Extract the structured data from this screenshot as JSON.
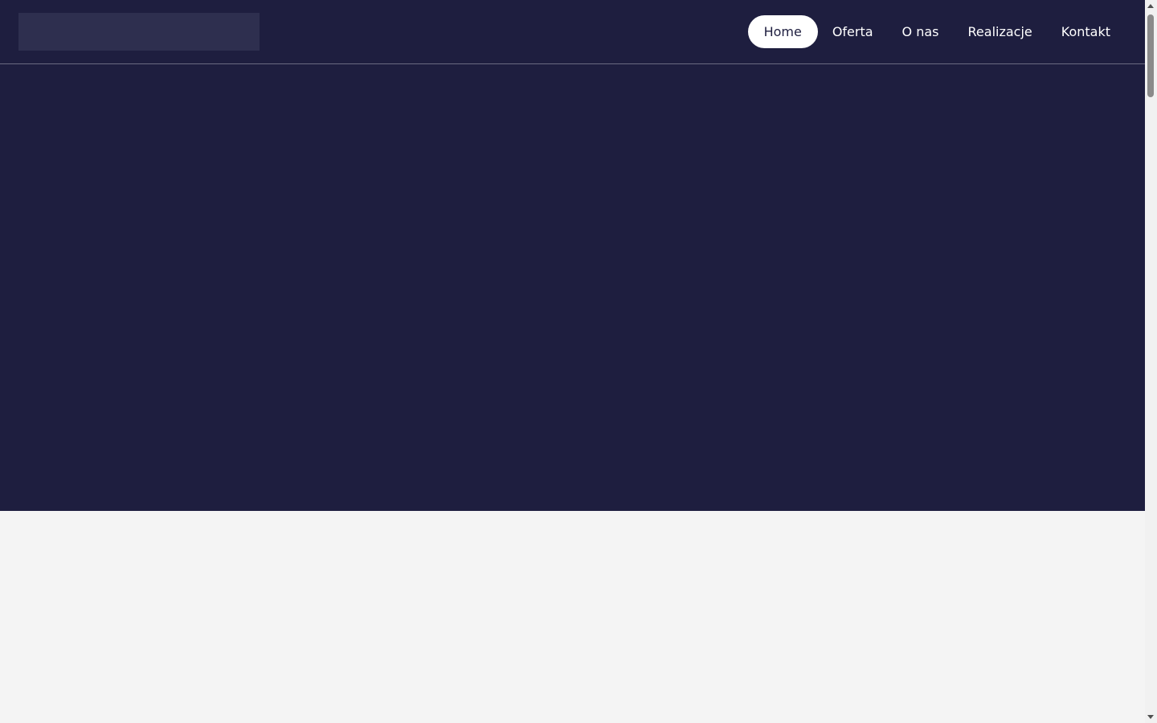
{
  "header": {
    "nav": [
      {
        "label": "Home",
        "active": true
      },
      {
        "label": "Oferta",
        "active": false
      },
      {
        "label": "O nas",
        "active": false
      },
      {
        "label": "Realizacje",
        "active": false
      },
      {
        "label": "Kontakt",
        "active": false
      }
    ]
  },
  "colors": {
    "primary": "#1e1e3f",
    "logo_placeholder": "#2e2f4f",
    "active_nav_bg": "#ffffff",
    "page_bg": "#f4f4f4"
  },
  "scroll": {
    "position_fraction": 0.0
  }
}
